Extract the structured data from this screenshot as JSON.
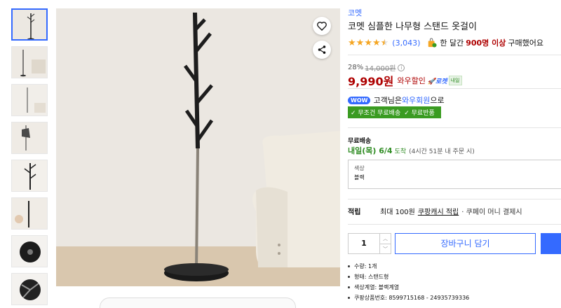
{
  "brand": "코멧",
  "product_title": "코멧 심플한 나무형 스탠드 옷걸이",
  "rating": {
    "stars": 4.5,
    "review_count": "(3,043)"
  },
  "purchase_note": {
    "prefix": "한 달간",
    "count": "900명 이상",
    "suffix": "구매했어요"
  },
  "discount": {
    "rate": "28%",
    "original_price": "14,000원",
    "info_icon": "i"
  },
  "price": {
    "sale_price": "9,990원",
    "wow_label": "와우할인",
    "rocket_label": "로켓",
    "delivery_tag": "내일"
  },
  "wow": {
    "badge": "WOW",
    "text_prefix": "고객님은",
    "link": "와우회원",
    "text_suffix": "으로"
  },
  "benefit_badges": [
    "✓ 무조건 무료배송",
    "✓ 무료반품"
  ],
  "shipping": {
    "label": "무료배송",
    "date": "내일(목) 6/4",
    "arrive": "도착",
    "note": "(4시간 51분 내 주문 시)"
  },
  "option": {
    "label": "색상",
    "value": "블랙"
  },
  "points": {
    "title": "적립",
    "text": "최대 100원",
    "link": "쿠팡캐시 적립",
    "extra": "· 쿠페이 머니 결제시"
  },
  "quantity": {
    "value": "1",
    "up": "︿",
    "down": "﹀"
  },
  "cart_button": "장바구니 담기",
  "specs": [
    "수량: 1개",
    "형태: 스탠드형",
    "색상계열: 블랙계열",
    "쿠팡상품번호: 8599715168 - 24935739336"
  ],
  "colors": {
    "accent": "#346aff",
    "price": "#ae0000",
    "green": "#3a9b21",
    "star": "#f5a623"
  },
  "icons": {
    "wish": "heart-icon",
    "share": "share-icon"
  }
}
